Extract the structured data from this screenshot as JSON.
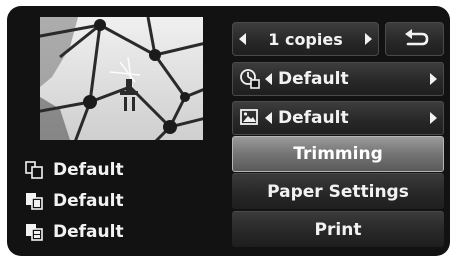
{
  "copies": {
    "label": "1 copies",
    "decrease_icon": "triangle-left-icon",
    "increase_icon": "triangle-right-icon"
  },
  "back_button": {
    "icon": "return-arrow-icon"
  },
  "settings": [
    {
      "icon": "date-print-icon",
      "value": "Default"
    },
    {
      "icon": "image-optimize-icon",
      "value": "Default"
    }
  ],
  "menu": {
    "items": [
      {
        "label": "Trimming",
        "selected": true
      },
      {
        "label": "Paper Settings",
        "selected": false
      },
      {
        "label": "Print",
        "selected": false
      }
    ],
    "selected_color": "#8a8a8a"
  },
  "status": [
    {
      "icon": "paper-size-icon",
      "value": "Default"
    },
    {
      "icon": "paper-type-icon",
      "value": "Default"
    },
    {
      "icon": "layout-icon",
      "value": "Default"
    }
  ],
  "preview": {
    "icon": "photo-thumbnail"
  }
}
